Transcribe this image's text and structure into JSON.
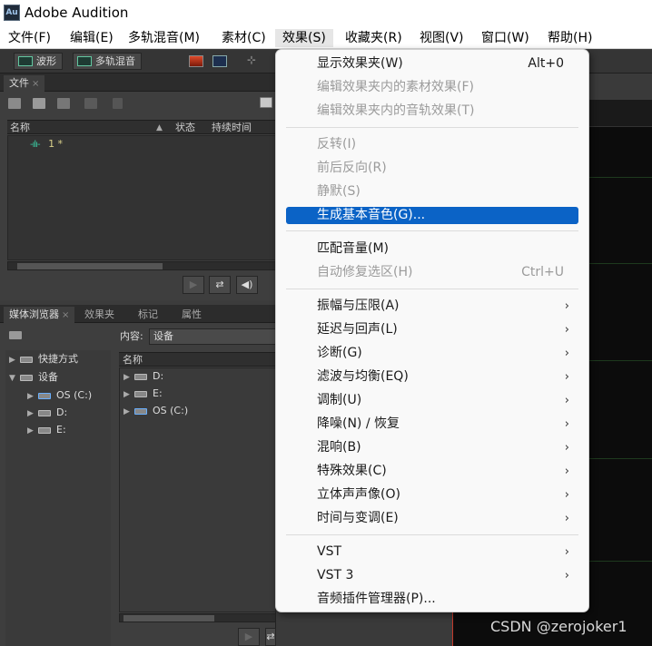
{
  "app": {
    "logo_text": "Au",
    "title": "Adobe Audition"
  },
  "menubar": {
    "items": [
      "文件(F)",
      "编辑(E)",
      "多轨混音(M)",
      "素材(C)",
      "效果(S)",
      "收藏夹(R)",
      "视图(V)",
      "窗口(W)",
      "帮助(H)"
    ],
    "active_index": 4
  },
  "toolbar": {
    "waveform_label": "波形",
    "multitrack_label": "多轨混音"
  },
  "files_panel": {
    "tab_label": "文件",
    "columns": [
      "名称",
      "状态",
      "持续时间"
    ],
    "items": [
      {
        "name": "1 *",
        "icon": "waveform-icon"
      }
    ]
  },
  "media_panel": {
    "tabs": [
      "媒体浏览器",
      "效果夹",
      "标记",
      "属性"
    ],
    "content_label": "内容:",
    "content_value": "设备",
    "tree": [
      {
        "label": "快捷方式",
        "level": 0,
        "expanded": false
      },
      {
        "label": "设备",
        "level": 0,
        "expanded": true
      },
      {
        "label": "OS (C:)",
        "level": 1
      },
      {
        "label": "D:",
        "level": 1
      },
      {
        "label": "E:",
        "level": 1
      }
    ],
    "list_header": "名称",
    "list_items": [
      "D:",
      "E:",
      "OS (C:)"
    ]
  },
  "effects_menu": {
    "items": [
      {
        "label": "显示效果夹(W)",
        "shortcut": "Alt+0",
        "disabled": false
      },
      {
        "label": "编辑效果夹内的素材效果(F)",
        "disabled": true
      },
      {
        "label": "编辑效果夹内的音轨效果(T)",
        "disabled": true
      },
      {
        "label": "反转(I)",
        "disabled": true
      },
      {
        "label": "前后反向(R)",
        "disabled": true
      },
      {
        "label": "静默(S)",
        "disabled": true
      },
      {
        "label": "生成基本音色(G)...",
        "disabled": false,
        "highlighted": true
      },
      {
        "label": "匹配音量(M)",
        "disabled": false
      },
      {
        "label": "自动修复选区(H)",
        "shortcut": "Ctrl+U",
        "disabled": true
      },
      {
        "label": "振幅与压限(A)",
        "submenu": true
      },
      {
        "label": "延迟与回声(L)",
        "submenu": true
      },
      {
        "label": "诊断(G)",
        "submenu": true
      },
      {
        "label": "滤波与均衡(EQ)",
        "submenu": true
      },
      {
        "label": "调制(U)",
        "submenu": true
      },
      {
        "label": "降噪(N) / 恢复",
        "submenu": true
      },
      {
        "label": "混响(B)",
        "submenu": true
      },
      {
        "label": "特殊效果(C)",
        "submenu": true
      },
      {
        "label": "立体声声像(O)",
        "submenu": true
      },
      {
        "label": "时间与变调(E)",
        "submenu": true
      },
      {
        "label": "VST",
        "submenu": true
      },
      {
        "label": "VST 3",
        "submenu": true
      },
      {
        "label": "音频插件管理器(P)...",
        "submenu": false
      }
    ]
  },
  "watermark": "CSDN @zerojoker1",
  "colors": {
    "highlight": "#0b63c6",
    "accent_green": "#3ac7a0",
    "playhead": "#c0392b"
  }
}
